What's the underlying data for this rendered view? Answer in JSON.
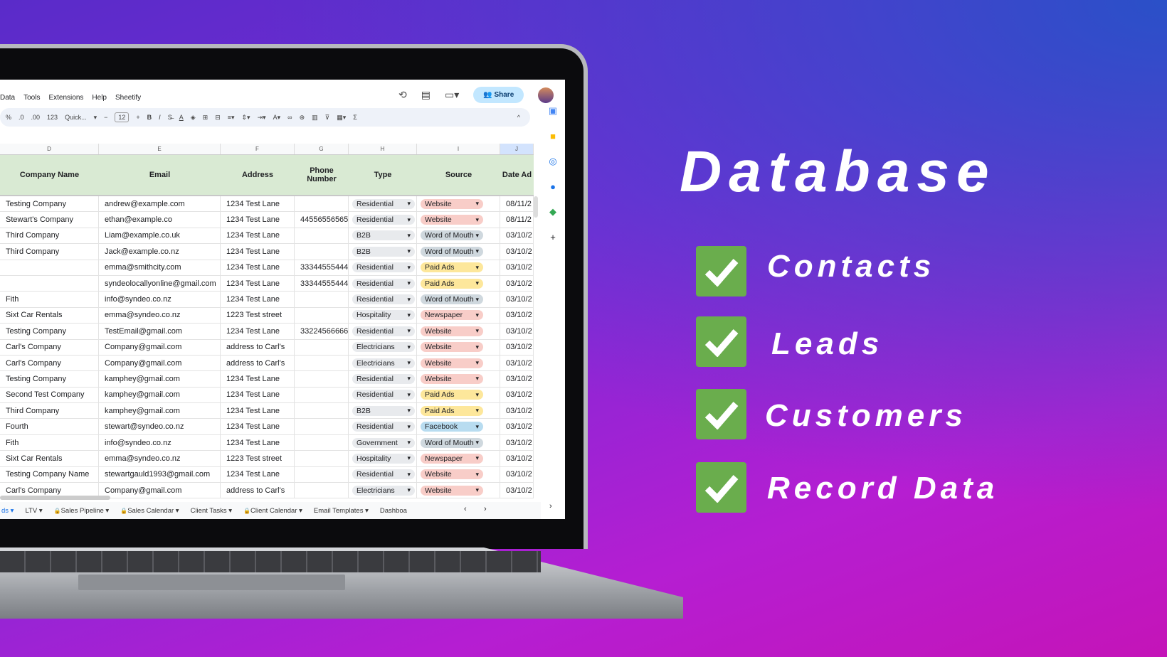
{
  "menu": [
    "Data",
    "Tools",
    "Extensions",
    "Help",
    "Sheetify"
  ],
  "share_label": "Share",
  "toolbar": {
    "percent": "%",
    "dec_less": ".0",
    "dec_more": ".00",
    "num": "123",
    "font": "Quick...",
    "font_size": "12",
    "bold": "B",
    "italic": "I",
    "sum": "Σ"
  },
  "columns": [
    "D",
    "E",
    "F",
    "G",
    "H",
    "I",
    "J"
  ],
  "headers": [
    "Company Name",
    "Email",
    "Address",
    "Phone Number",
    "Type",
    "Source",
    "Date Ad"
  ],
  "source_colors": {
    "Website": "#f8cdc8",
    "Word of Mouth": "#cfd8de",
    "Paid Ads": "#fde79b",
    "Newspaper": "#f8cdc8",
    "Facebook": "#b8dcf0"
  },
  "rows": [
    [
      "Testing Company",
      "andrew@example.com",
      "1234 Test Lane",
      "",
      "Residential",
      "Website",
      "08/11/2"
    ],
    [
      "Stewart's Company",
      "ethan@example.co",
      "1234 Test Lane",
      "44556556565",
      "Residential",
      "Website",
      "08/11/2"
    ],
    [
      "Third Company",
      "Liam@example.co.uk",
      "1234 Test Lane",
      "",
      "B2B",
      "Word of Mouth",
      "03/10/2"
    ],
    [
      "Third Company",
      "Jack@example.co.nz",
      "1234 Test Lane",
      "",
      "B2B",
      "Word of Mouth",
      "03/10/2"
    ],
    [
      "",
      "emma@smithcity.com",
      "1234 Test Lane",
      "33344555444",
      "Residential",
      "Paid Ads",
      "03/10/2"
    ],
    [
      "",
      "syndeolocallyonline@gmail.com",
      "1234 Test Lane",
      "33344555444",
      "Residential",
      "Paid Ads",
      "03/10/2"
    ],
    [
      "Fith",
      "info@syndeo.co.nz",
      "1234 Test Lane",
      "",
      "Residential",
      "Word of Mouth",
      "03/10/2"
    ],
    [
      "Sixt Car Rentals",
      "emma@syndeo.co.nz",
      "1223 Test street",
      "",
      "Hospitality",
      "Newspaper",
      "03/10/2"
    ],
    [
      "Testing Company",
      "TestEmail@gmail.com",
      "1234 Test Lane",
      "33224566666",
      "Residential",
      "Website",
      "03/10/2"
    ],
    [
      "Carl's Company",
      "Company@gmail.com",
      "address to Carl's",
      "",
      "Electricians",
      "Website",
      "03/10/2"
    ],
    [
      "Carl's Company",
      "Company@gmail.com",
      "address to Carl's",
      "",
      "Electricians",
      "Website",
      "03/10/2"
    ],
    [
      "Testing Company",
      "kamphey@gmail.com",
      "1234 Test Lane",
      "",
      "Residential",
      "Website",
      "03/10/2"
    ],
    [
      "Second Test Company",
      "kamphey@gmail.com",
      "1234 Test Lane",
      "",
      "Residential",
      "Paid Ads",
      "03/10/2"
    ],
    [
      "Third Company",
      "kamphey@gmail.com",
      "1234 Test Lane",
      "",
      "B2B",
      "Paid Ads",
      "03/10/2"
    ],
    [
      "Fourth",
      "stewart@syndeo.co.nz",
      "1234 Test Lane",
      "",
      "Residential",
      "Facebook",
      "03/10/2"
    ],
    [
      "Fith",
      "info@syndeo.co.nz",
      "1234 Test Lane",
      "",
      "Government",
      "Word of Mouth",
      "03/10/2"
    ],
    [
      "Sixt Car Rentals",
      "emma@syndeo.co.nz",
      "1223 Test street",
      "",
      "Hospitality",
      "Newspaper",
      "03/10/2"
    ],
    [
      "Testing Company Name",
      "stewartgauld1993@gmail.com",
      "1234 Test Lane",
      "",
      "Residential",
      "Website",
      "03/10/2"
    ],
    [
      "Carl's Company",
      "Company@gmail.com",
      "address to Carl's",
      "",
      "Electricians",
      "Website",
      "03/10/2"
    ]
  ],
  "sheet_tabs": [
    "ds",
    "LTV",
    "Sales Pipeline",
    "Sales Calendar",
    "Client Tasks",
    "Client Calendar",
    "Email Templates",
    "Dashboa"
  ],
  "locked_tabs": [
    "Sales Pipeline",
    "Sales Calendar",
    "Client Calendar"
  ],
  "title": "Database",
  "features": [
    "Contacts",
    "Leads",
    "Customers",
    "Record Data"
  ],
  "check_color": "#6aad4d"
}
